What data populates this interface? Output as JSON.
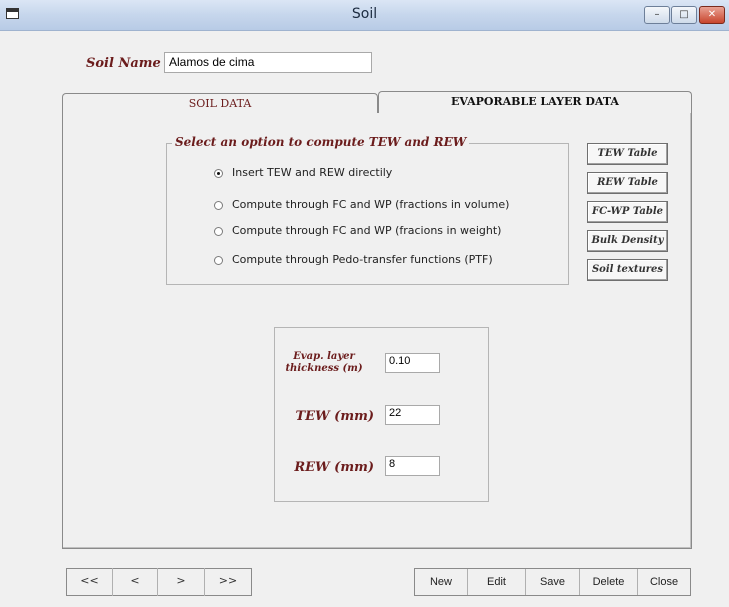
{
  "window": {
    "title": "Soil",
    "minimize_icon": "minimize-icon",
    "maximize_icon": "maximize-icon",
    "close_icon": "close-icon"
  },
  "soil_name": {
    "label": "Soil Name",
    "value": "Alamos de cima"
  },
  "tabs": [
    {
      "label": "SOIL DATA",
      "selected": false
    },
    {
      "label": "EVAPORABLE LAYER DATA",
      "selected": true
    }
  ],
  "options": {
    "legend": "Select an option to compute TEW and REW",
    "items": [
      {
        "label": "Insert TEW and REW directily",
        "selected": true
      },
      {
        "label": "Compute through FC and WP (fractions in volume)",
        "selected": false
      },
      {
        "label": "Compute through FC and WP (fracions in weight)",
        "selected": false
      },
      {
        "label": "Compute through Pedo-transfer functions (PTF)",
        "selected": false
      }
    ]
  },
  "side_buttons": [
    {
      "label": "TEW Table"
    },
    {
      "label": "REW Table"
    },
    {
      "label": "FC-WP Table"
    },
    {
      "label": "Bulk Density"
    },
    {
      "label": "Soil textures"
    }
  ],
  "evap": {
    "thickness_label_1": "Evap. layer",
    "thickness_label_2": "thickness (m)",
    "thickness_value": "0.10",
    "tew_label": "TEW (mm)",
    "tew_value": "22",
    "rew_label": "REW (mm)",
    "rew_value": "8"
  },
  "nav": {
    "first": "<<",
    "prev": "<",
    "next": ">",
    "last": ">>"
  },
  "actions": {
    "new": "New",
    "edit": "Edit",
    "save": "Save",
    "delete": "Delete",
    "close": "Close"
  },
  "colors": {
    "label_maroon": "#6b1c1c",
    "titlebar": "#c6d6ec",
    "close_button": "#c8452d"
  }
}
